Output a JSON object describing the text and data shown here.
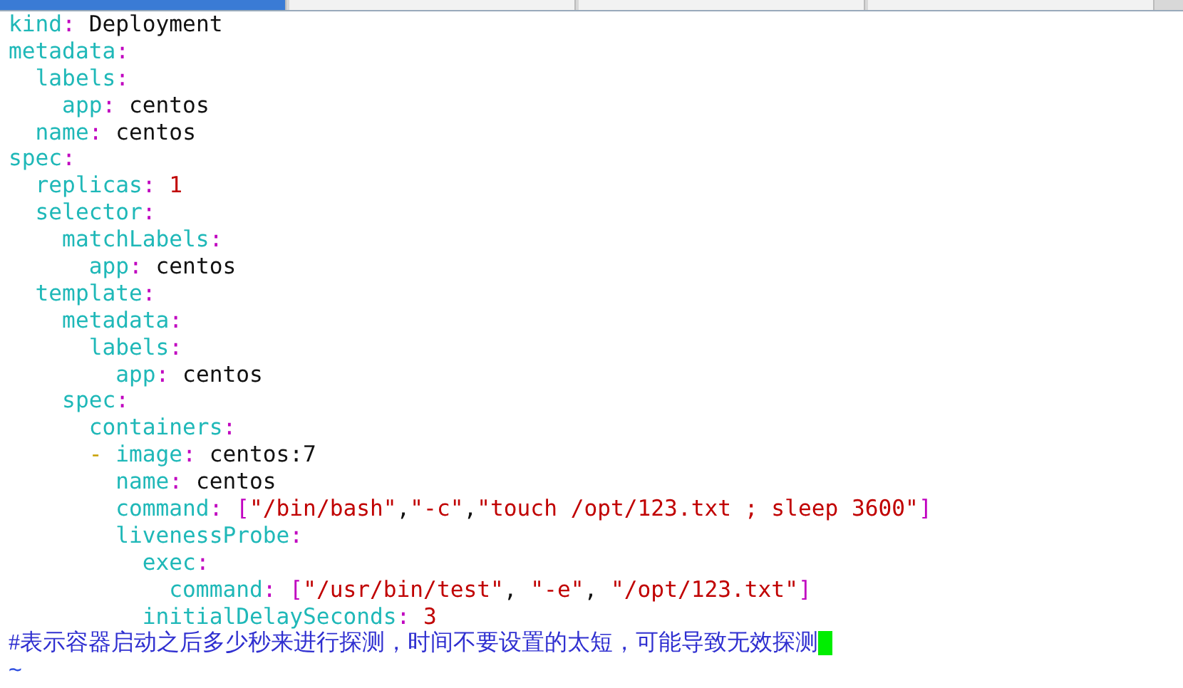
{
  "tabs": [
    {
      "selected": true
    },
    {
      "selected": false
    },
    {
      "selected": false
    },
    {
      "selected": false
    }
  ],
  "editor": {
    "lines": [
      {
        "segments": [
          {
            "kind": "key",
            "text": "kind"
          },
          {
            "kind": "colon",
            "text": ":"
          },
          {
            "kind": "plain",
            "text": " Deployment"
          }
        ]
      },
      {
        "segments": [
          {
            "kind": "key",
            "text": "metadata"
          },
          {
            "kind": "colon",
            "text": ":"
          }
        ]
      },
      {
        "segments": [
          {
            "kind": "key",
            "text": "  labels"
          },
          {
            "kind": "colon",
            "text": ":"
          }
        ]
      },
      {
        "segments": [
          {
            "kind": "key",
            "text": "    app"
          },
          {
            "kind": "colon",
            "text": ":"
          },
          {
            "kind": "plain",
            "text": " centos"
          }
        ]
      },
      {
        "segments": [
          {
            "kind": "key",
            "text": "  name"
          },
          {
            "kind": "colon",
            "text": ":"
          },
          {
            "kind": "plain",
            "text": " centos"
          }
        ]
      },
      {
        "segments": [
          {
            "kind": "key",
            "text": "spec"
          },
          {
            "kind": "colon",
            "text": ":"
          }
        ]
      },
      {
        "segments": [
          {
            "kind": "key",
            "text": "  replicas"
          },
          {
            "kind": "colon",
            "text": ":"
          },
          {
            "kind": "number",
            "text": " 1"
          }
        ]
      },
      {
        "segments": [
          {
            "kind": "key",
            "text": "  selector"
          },
          {
            "kind": "colon",
            "text": ":"
          }
        ]
      },
      {
        "segments": [
          {
            "kind": "key",
            "text": "    matchLabels"
          },
          {
            "kind": "colon",
            "text": ":"
          }
        ]
      },
      {
        "segments": [
          {
            "kind": "key",
            "text": "      app"
          },
          {
            "kind": "colon",
            "text": ":"
          },
          {
            "kind": "plain",
            "text": " centos"
          }
        ]
      },
      {
        "segments": [
          {
            "kind": "key",
            "text": "  template"
          },
          {
            "kind": "colon",
            "text": ":"
          }
        ]
      },
      {
        "segments": [
          {
            "kind": "key",
            "text": "    metadata"
          },
          {
            "kind": "colon",
            "text": ":"
          }
        ]
      },
      {
        "segments": [
          {
            "kind": "key",
            "text": "      labels"
          },
          {
            "kind": "colon",
            "text": ":"
          }
        ]
      },
      {
        "segments": [
          {
            "kind": "key",
            "text": "        app"
          },
          {
            "kind": "colon",
            "text": ":"
          },
          {
            "kind": "plain",
            "text": " centos"
          }
        ]
      },
      {
        "segments": [
          {
            "kind": "key",
            "text": "    spec"
          },
          {
            "kind": "colon",
            "text": ":"
          }
        ]
      },
      {
        "segments": [
          {
            "kind": "key",
            "text": "      containers"
          },
          {
            "kind": "colon",
            "text": ":"
          }
        ]
      },
      {
        "segments": [
          {
            "kind": "dash",
            "text": "      -"
          },
          {
            "kind": "key",
            "text": " image"
          },
          {
            "kind": "colon",
            "text": ":"
          },
          {
            "kind": "plain",
            "text": " centos:7"
          }
        ]
      },
      {
        "segments": [
          {
            "kind": "key",
            "text": "        name"
          },
          {
            "kind": "colon",
            "text": ":"
          },
          {
            "kind": "plain",
            "text": " centos"
          }
        ]
      },
      {
        "segments": [
          {
            "kind": "key",
            "text": "        command"
          },
          {
            "kind": "colon",
            "text": ":"
          },
          {
            "kind": "bracket",
            "text": " ["
          },
          {
            "kind": "string",
            "text": "\"/bin/bash\""
          },
          {
            "kind": "plain",
            "text": ","
          },
          {
            "kind": "string",
            "text": "\"-c\""
          },
          {
            "kind": "plain",
            "text": ","
          },
          {
            "kind": "string",
            "text": "\"touch /opt/123.txt ; sleep 3600\""
          },
          {
            "kind": "bracket",
            "text": "]"
          }
        ]
      },
      {
        "segments": [
          {
            "kind": "key",
            "text": "        livenessProbe"
          },
          {
            "kind": "colon",
            "text": ":"
          }
        ]
      },
      {
        "segments": [
          {
            "kind": "key",
            "text": "          exec"
          },
          {
            "kind": "colon",
            "text": ":"
          }
        ]
      },
      {
        "segments": [
          {
            "kind": "key",
            "text": "            command"
          },
          {
            "kind": "colon",
            "text": ":"
          },
          {
            "kind": "bracket",
            "text": " ["
          },
          {
            "kind": "string",
            "text": "\"/usr/bin/test\""
          },
          {
            "kind": "plain",
            "text": ", "
          },
          {
            "kind": "string",
            "text": "\"-e\""
          },
          {
            "kind": "plain",
            "text": ", "
          },
          {
            "kind": "string",
            "text": "\"/opt/123.txt\""
          },
          {
            "kind": "bracket",
            "text": "]"
          }
        ]
      },
      {
        "segments": [
          {
            "kind": "key",
            "text": "          initialDelaySeconds"
          },
          {
            "kind": "colon",
            "text": ":"
          },
          {
            "kind": "number",
            "text": " 3"
          }
        ]
      },
      {
        "segments": [
          {
            "kind": "comment",
            "text": "#表示容器启动之后多少秒来进行探测，时间不要设置的太短，可能导致无效探测"
          }
        ],
        "cursor": true
      },
      {
        "segments": [
          {
            "kind": "tilde",
            "text": "~"
          }
        ]
      }
    ]
  }
}
